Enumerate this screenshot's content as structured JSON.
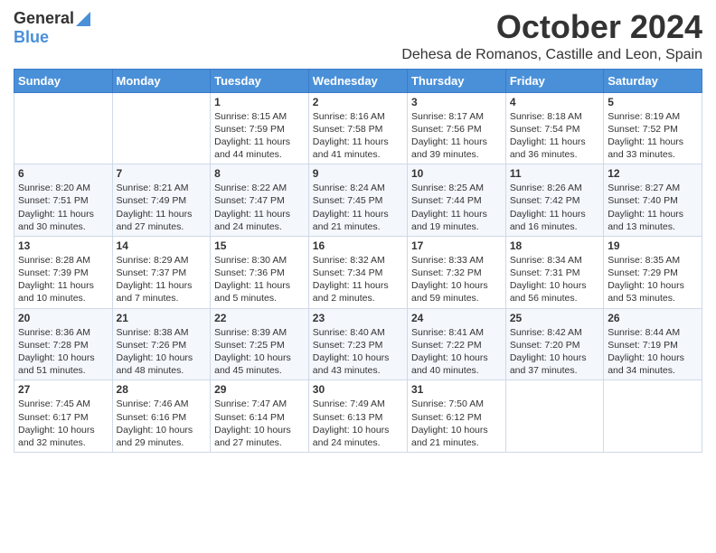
{
  "logo": {
    "text_general": "General",
    "text_blue": "Blue"
  },
  "header": {
    "month": "October 2024",
    "location": "Dehesa de Romanos, Castille and Leon, Spain"
  },
  "weekdays": [
    "Sunday",
    "Monday",
    "Tuesday",
    "Wednesday",
    "Thursday",
    "Friday",
    "Saturday"
  ],
  "weeks": [
    [
      {
        "day": "",
        "info": ""
      },
      {
        "day": "",
        "info": ""
      },
      {
        "day": "1",
        "info": "Sunrise: 8:15 AM\nSunset: 7:59 PM\nDaylight: 11 hours and 44 minutes."
      },
      {
        "day": "2",
        "info": "Sunrise: 8:16 AM\nSunset: 7:58 PM\nDaylight: 11 hours and 41 minutes."
      },
      {
        "day": "3",
        "info": "Sunrise: 8:17 AM\nSunset: 7:56 PM\nDaylight: 11 hours and 39 minutes."
      },
      {
        "day": "4",
        "info": "Sunrise: 8:18 AM\nSunset: 7:54 PM\nDaylight: 11 hours and 36 minutes."
      },
      {
        "day": "5",
        "info": "Sunrise: 8:19 AM\nSunset: 7:52 PM\nDaylight: 11 hours and 33 minutes."
      }
    ],
    [
      {
        "day": "6",
        "info": "Sunrise: 8:20 AM\nSunset: 7:51 PM\nDaylight: 11 hours and 30 minutes."
      },
      {
        "day": "7",
        "info": "Sunrise: 8:21 AM\nSunset: 7:49 PM\nDaylight: 11 hours and 27 minutes."
      },
      {
        "day": "8",
        "info": "Sunrise: 8:22 AM\nSunset: 7:47 PM\nDaylight: 11 hours and 24 minutes."
      },
      {
        "day": "9",
        "info": "Sunrise: 8:24 AM\nSunset: 7:45 PM\nDaylight: 11 hours and 21 minutes."
      },
      {
        "day": "10",
        "info": "Sunrise: 8:25 AM\nSunset: 7:44 PM\nDaylight: 11 hours and 19 minutes."
      },
      {
        "day": "11",
        "info": "Sunrise: 8:26 AM\nSunset: 7:42 PM\nDaylight: 11 hours and 16 minutes."
      },
      {
        "day": "12",
        "info": "Sunrise: 8:27 AM\nSunset: 7:40 PM\nDaylight: 11 hours and 13 minutes."
      }
    ],
    [
      {
        "day": "13",
        "info": "Sunrise: 8:28 AM\nSunset: 7:39 PM\nDaylight: 11 hours and 10 minutes."
      },
      {
        "day": "14",
        "info": "Sunrise: 8:29 AM\nSunset: 7:37 PM\nDaylight: 11 hours and 7 minutes."
      },
      {
        "day": "15",
        "info": "Sunrise: 8:30 AM\nSunset: 7:36 PM\nDaylight: 11 hours and 5 minutes."
      },
      {
        "day": "16",
        "info": "Sunrise: 8:32 AM\nSunset: 7:34 PM\nDaylight: 11 hours and 2 minutes."
      },
      {
        "day": "17",
        "info": "Sunrise: 8:33 AM\nSunset: 7:32 PM\nDaylight: 10 hours and 59 minutes."
      },
      {
        "day": "18",
        "info": "Sunrise: 8:34 AM\nSunset: 7:31 PM\nDaylight: 10 hours and 56 minutes."
      },
      {
        "day": "19",
        "info": "Sunrise: 8:35 AM\nSunset: 7:29 PM\nDaylight: 10 hours and 53 minutes."
      }
    ],
    [
      {
        "day": "20",
        "info": "Sunrise: 8:36 AM\nSunset: 7:28 PM\nDaylight: 10 hours and 51 minutes."
      },
      {
        "day": "21",
        "info": "Sunrise: 8:38 AM\nSunset: 7:26 PM\nDaylight: 10 hours and 48 minutes."
      },
      {
        "day": "22",
        "info": "Sunrise: 8:39 AM\nSunset: 7:25 PM\nDaylight: 10 hours and 45 minutes."
      },
      {
        "day": "23",
        "info": "Sunrise: 8:40 AM\nSunset: 7:23 PM\nDaylight: 10 hours and 43 minutes."
      },
      {
        "day": "24",
        "info": "Sunrise: 8:41 AM\nSunset: 7:22 PM\nDaylight: 10 hours and 40 minutes."
      },
      {
        "day": "25",
        "info": "Sunrise: 8:42 AM\nSunset: 7:20 PM\nDaylight: 10 hours and 37 minutes."
      },
      {
        "day": "26",
        "info": "Sunrise: 8:44 AM\nSunset: 7:19 PM\nDaylight: 10 hours and 34 minutes."
      }
    ],
    [
      {
        "day": "27",
        "info": "Sunrise: 7:45 AM\nSunset: 6:17 PM\nDaylight: 10 hours and 32 minutes."
      },
      {
        "day": "28",
        "info": "Sunrise: 7:46 AM\nSunset: 6:16 PM\nDaylight: 10 hours and 29 minutes."
      },
      {
        "day": "29",
        "info": "Sunrise: 7:47 AM\nSunset: 6:14 PM\nDaylight: 10 hours and 27 minutes."
      },
      {
        "day": "30",
        "info": "Sunrise: 7:49 AM\nSunset: 6:13 PM\nDaylight: 10 hours and 24 minutes."
      },
      {
        "day": "31",
        "info": "Sunrise: 7:50 AM\nSunset: 6:12 PM\nDaylight: 10 hours and 21 minutes."
      },
      {
        "day": "",
        "info": ""
      },
      {
        "day": "",
        "info": ""
      }
    ]
  ]
}
